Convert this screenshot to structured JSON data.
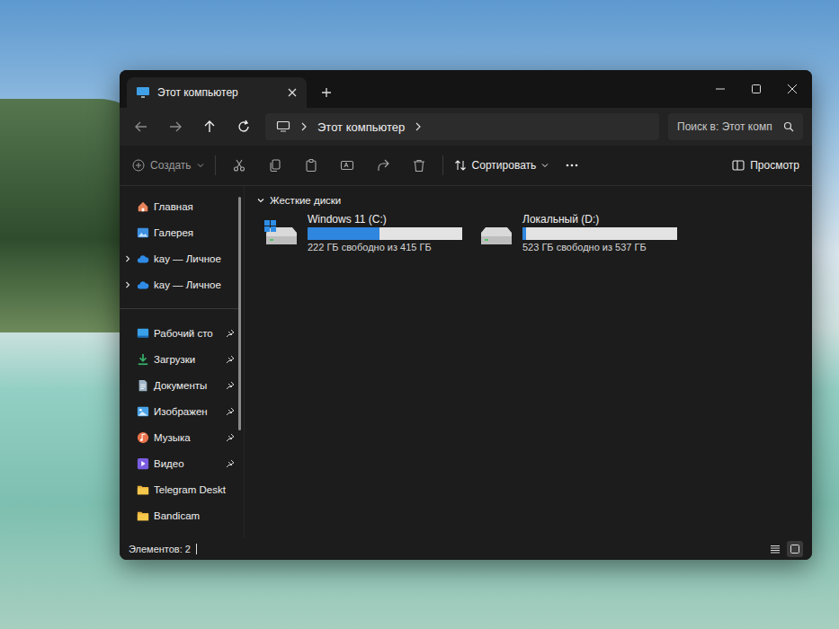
{
  "window": {
    "title": "Этот компьютер"
  },
  "address": {
    "crumbs": [
      "Этот компьютер"
    ]
  },
  "search": {
    "placeholder": "Поиск в: Этот комп"
  },
  "toolbar": {
    "create": "Создать",
    "sort": "Сортировать",
    "preview": "Просмотр"
  },
  "sidebar": {
    "sections": [
      {
        "items": [
          {
            "label": "Главная",
            "kind": "home",
            "pinned": false,
            "expandable": false
          },
          {
            "label": "Галерея",
            "kind": "gallery",
            "pinned": false,
            "expandable": false
          },
          {
            "label": "kay — Личное",
            "kind": "cloud",
            "pinned": false,
            "expandable": true
          },
          {
            "label": "kay — Личное",
            "kind": "cloud",
            "pinned": false,
            "expandable": true
          }
        ]
      },
      {
        "items": [
          {
            "label": "Рабочий сто",
            "kind": "desktop",
            "pinned": true,
            "expandable": false
          },
          {
            "label": "Загрузки",
            "kind": "downloads",
            "pinned": true,
            "expandable": false
          },
          {
            "label": "Документы",
            "kind": "documents",
            "pinned": true,
            "expandable": false
          },
          {
            "label": "Изображен",
            "kind": "pictures",
            "pinned": true,
            "expandable": false
          },
          {
            "label": "Музыка",
            "kind": "music",
            "pinned": true,
            "expandable": false
          },
          {
            "label": "Видео",
            "kind": "video",
            "pinned": true,
            "expandable": false
          },
          {
            "label": "Telegram Deskt",
            "kind": "folder",
            "pinned": false,
            "expandable": false
          },
          {
            "label": "Bandicam",
            "kind": "folder",
            "pinned": false,
            "expandable": false
          }
        ]
      }
    ]
  },
  "section": {
    "title": "Жесткие диски",
    "expanded": true
  },
  "drives": [
    {
      "name": "Windows 11 (C:)",
      "kind": "system",
      "level": 0.465,
      "reading": "222 ГБ свободно из 415 ГБ"
    },
    {
      "name": "Локальный (D:)",
      "kind": "local",
      "level": 0.026,
      "reading": "523 ГБ свободно из 537 ГБ"
    }
  ],
  "status_bar": {
    "count": "Элементов: 2"
  },
  "view_modes": [
    {
      "kind": "details",
      "selected": false
    },
    {
      "kind": "tiles",
      "selected": true
    }
  ]
}
